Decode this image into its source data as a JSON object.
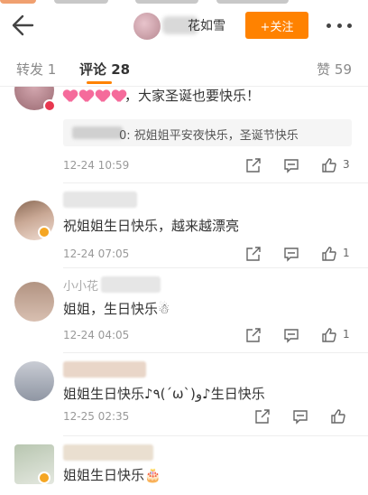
{
  "header": {
    "user_name_visible": "花如雪",
    "follow_label": "+关注"
  },
  "tabs": {
    "repost": "转发 1",
    "comments": "评论 28",
    "likes": "赞 59"
  },
  "icons": {
    "back": "arrow-left-icon",
    "more": "more-dots-icon",
    "share": "share-icon",
    "reply": "comment-icon",
    "like": "thumbs-up-icon"
  },
  "colors": {
    "accent": "#ff8200",
    "heart": "#f56b9b",
    "verified": "#f5a623"
  },
  "comments": [
    {
      "text": "，大家圣诞也要快乐！",
      "quote_suffix": "0: 祝姐姐平安夜快乐，圣诞节快乐",
      "time": "12-24 10:59",
      "like_count": "3"
    },
    {
      "text": "祝姐姐生日快乐，越来越漂亮",
      "time": "12-24 07:05",
      "like_count": "1"
    },
    {
      "name_partial": "小小花",
      "text": "姐姐，生日快乐☃",
      "time": "12-24 04:05",
      "like_count": "1"
    },
    {
      "text": "姐姐生日快乐♪٩(´ω`)و♪生日快乐",
      "time": "12-25 02:35",
      "like_count": ""
    },
    {
      "text": "姐姐生日快乐🎂",
      "time": "",
      "like_count": ""
    }
  ]
}
